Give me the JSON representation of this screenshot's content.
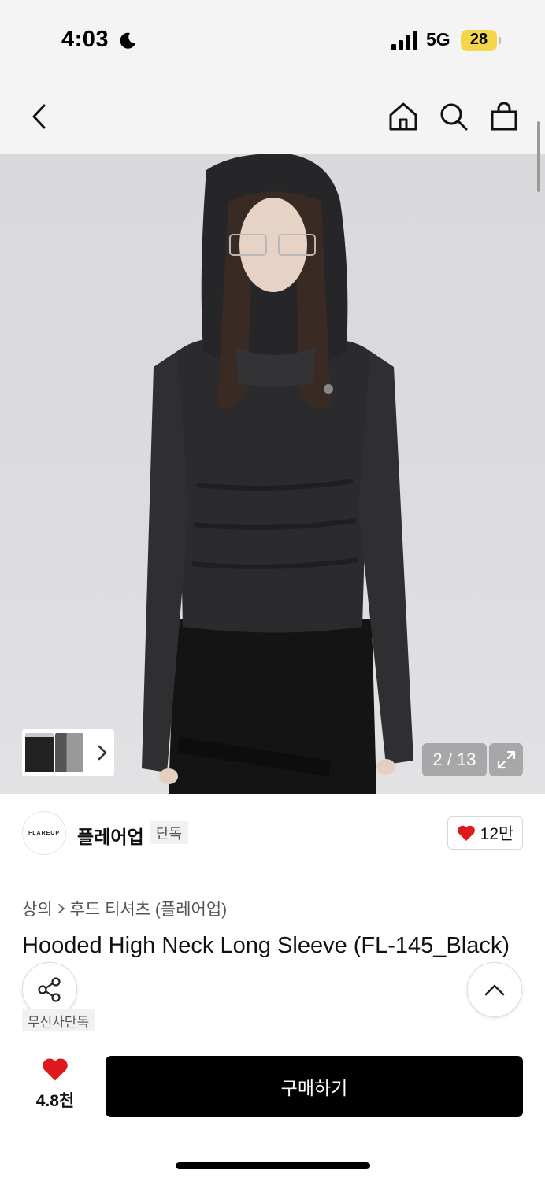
{
  "status_bar": {
    "time": "4:03",
    "network": "5G",
    "battery": "28",
    "icons": [
      "moon-icon",
      "signal-icon",
      "battery-icon"
    ]
  },
  "nav": {
    "icons": [
      "back-arrow-icon",
      "home-icon",
      "search-icon",
      "shopping-bag-icon"
    ]
  },
  "gallery": {
    "counter": "2 / 13",
    "icons": [
      "chevron-right-icon",
      "expand-icon"
    ]
  },
  "brand": {
    "logo_text": "FLAREUP",
    "name": "플레어업",
    "badge": "단독",
    "likes": "12만"
  },
  "breadcrumb": {
    "category": "상의",
    "subcategory": "후드 티셔츠 (플레어업)"
  },
  "product": {
    "title": "Hooded High Neck Long Sleeve (FL-145_Black)",
    "tag": "무신사단독"
  },
  "bottom": {
    "wish_count": "4.8천",
    "buy_label": "구매하기"
  },
  "colors": {
    "accent_red": "#e0191f",
    "battery_yellow": "#f3d64a",
    "buy_button": "#000000"
  }
}
